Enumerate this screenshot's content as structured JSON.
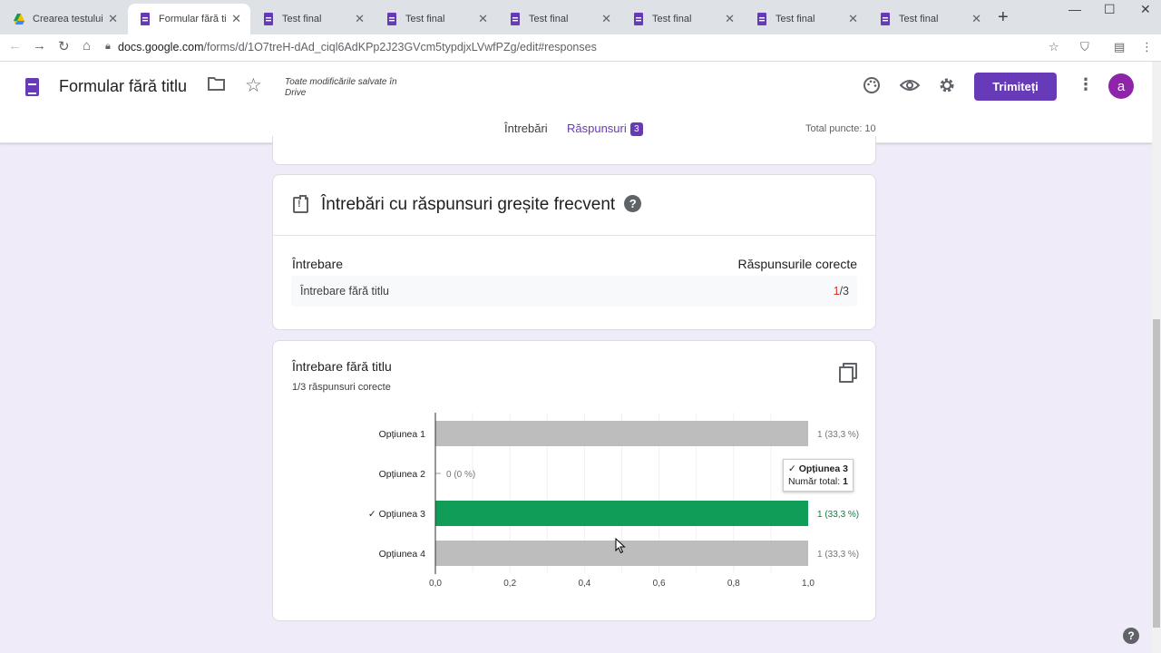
{
  "browser": {
    "tabs": [
      {
        "title": "Crearea testului -",
        "icon": "google-drive-icon",
        "active": false
      },
      {
        "title": "Formular fără titlu",
        "icon": "google-forms-icon",
        "active": true
      },
      {
        "title": "Test final",
        "icon": "google-forms-icon",
        "active": false
      },
      {
        "title": "Test final",
        "icon": "google-forms-icon",
        "active": false
      },
      {
        "title": "Test final",
        "icon": "google-forms-icon",
        "active": false
      },
      {
        "title": "Test final",
        "icon": "google-forms-icon",
        "active": false
      },
      {
        "title": "Test final",
        "icon": "google-forms-icon",
        "active": false
      },
      {
        "title": "Test final",
        "icon": "google-forms-icon",
        "active": false
      }
    ],
    "url_host": "docs.google.com",
    "url_path": "/forms/d/1O7treH-dAd_ciql6AdKPp2J23GVcm5typdjxLVwfPZg/edit#responses"
  },
  "header": {
    "title": "Formular fără titlu",
    "saved_status": "Toate modificările salvate în Drive",
    "send_label": "Trimiteți",
    "avatar_letter": "a",
    "tabs": {
      "questions": "Întrebări",
      "responses": "Răspunsuri",
      "responses_count": "3"
    },
    "total_points": "Total puncte: 10",
    "accent": "#673ab7"
  },
  "frequent_wrong": {
    "title": "Întrebări cu răspunsuri greșite frecvent",
    "col_question": "Întrebare",
    "col_correct": "Răspunsurile corecte",
    "rows": [
      {
        "question": "Întrebare fără titlu",
        "correct": "1",
        "total": "/3"
      }
    ]
  },
  "question_card": {
    "title": "Întrebare fără titlu",
    "subtitle": "1/3 răspunsuri corecte",
    "tooltip": {
      "line1": "✓ Opțiunea 3",
      "line2_label": "Număr total:",
      "line2_value": "1"
    }
  },
  "chart_data": {
    "type": "bar",
    "orientation": "horizontal",
    "categories": [
      "Opțiunea 1",
      "Opțiunea 2",
      "✓ Opțiunea 3",
      "Opțiunea 4"
    ],
    "values": [
      1,
      0,
      1,
      1
    ],
    "value_labels": [
      "1 (33,3 %)",
      "0 (0 %)",
      "1 (33,3 %)",
      "1 (33,3 %)"
    ],
    "correct_index": 2,
    "xlim": [
      0,
      1
    ],
    "xticks": [
      "0,0",
      "0,2",
      "0,4",
      "0,6",
      "0,8",
      "1,0"
    ],
    "colors": {
      "default": "#bdbdbd",
      "correct": "#0f9d58",
      "correct_label": "#0b8043"
    },
    "grid": true,
    "title": "",
    "xlabel": "",
    "ylabel": ""
  }
}
